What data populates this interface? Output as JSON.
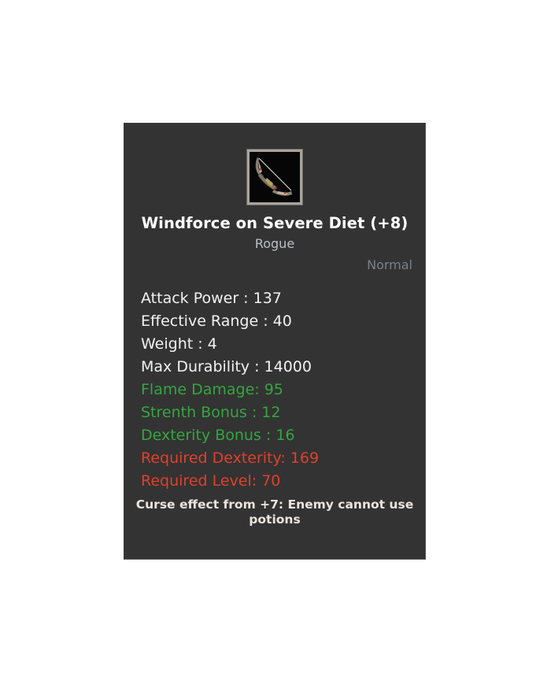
{
  "tooltip": {
    "icon_name": "bow-weapon-icon",
    "title": "Windforce on Severe Diet (+8)",
    "class_restriction": "Rogue",
    "rarity": "Normal",
    "stats": [
      {
        "text": "Attack Power : 137",
        "kind": "base"
      },
      {
        "text": "Effective Range : 40",
        "kind": "base"
      },
      {
        "text": "Weight : 4",
        "kind": "base"
      },
      {
        "text": "Max Durability : 14000",
        "kind": "base"
      },
      {
        "text": "Flame Damage: 95",
        "kind": "bonus"
      },
      {
        "text": "Strenth Bonus : 12",
        "kind": "bonus"
      },
      {
        "text": "Dexterity Bonus : 16",
        "kind": "bonus"
      },
      {
        "text": "Required Dexterity: 169",
        "kind": "require"
      },
      {
        "text": "Required Level: 70",
        "kind": "require"
      }
    ],
    "curse_effect": "Curse effect from +7: Enemy cannot use potions",
    "colors": {
      "panel_background": "#333333",
      "page_background": "#ffffff",
      "title": "#ffffff",
      "subtitle": "#b9c1c9",
      "rarity": "#79808a",
      "base_stat": "#f2f2f2",
      "bonus_stat": "#33a73f",
      "requirement_stat": "#e0402c",
      "curse_text": "#e9e5dd",
      "icon_frame": "#a9a59d"
    }
  }
}
